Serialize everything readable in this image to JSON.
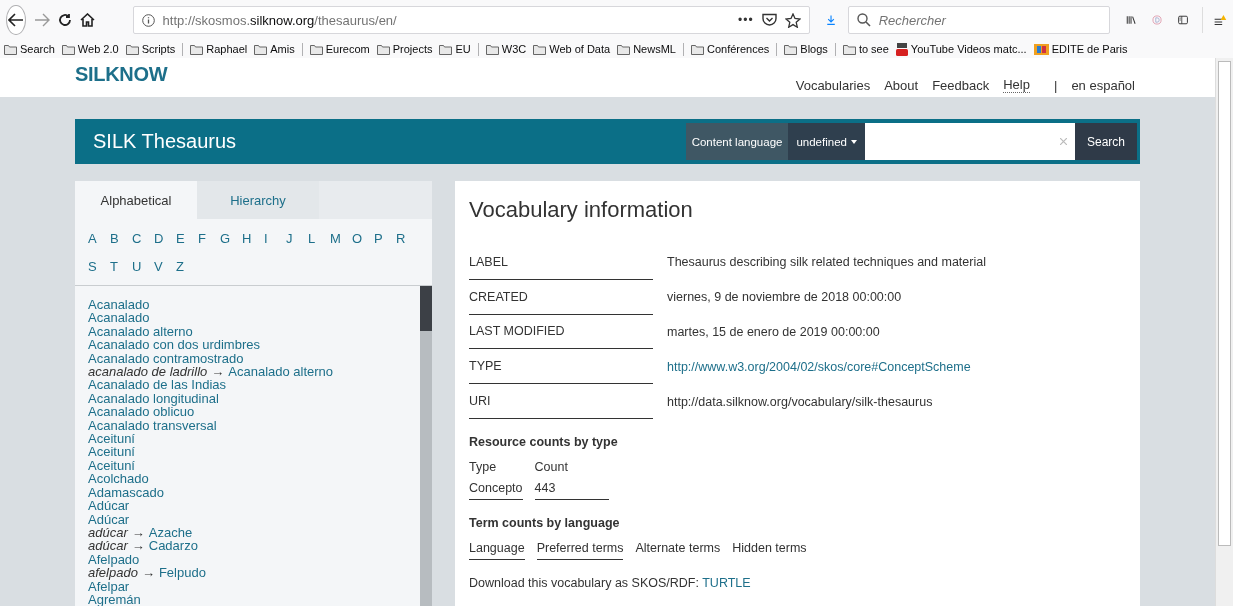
{
  "browser": {
    "url": {
      "prefix": "http://skosmos.",
      "host": "silknow.org",
      "path": "/thesaurus/en/"
    },
    "more": "•••",
    "search_placeholder": "Rechercher",
    "bookmarks": [
      {
        "kind": "folder",
        "label": "Search"
      },
      {
        "kind": "folder",
        "label": "Web 2.0"
      },
      {
        "kind": "folder",
        "label": "Scripts"
      },
      {
        "kind": "separator"
      },
      {
        "kind": "folder",
        "label": "Raphael"
      },
      {
        "kind": "folder",
        "label": "Amis"
      },
      {
        "kind": "separator"
      },
      {
        "kind": "folder",
        "label": "Eurecom"
      },
      {
        "kind": "folder",
        "label": "Projects"
      },
      {
        "kind": "folder",
        "label": "EU"
      },
      {
        "kind": "separator"
      },
      {
        "kind": "folder",
        "label": "W3C"
      },
      {
        "kind": "folder",
        "label": "Web of Data"
      },
      {
        "kind": "folder",
        "label": "NewsML"
      },
      {
        "kind": "separator"
      },
      {
        "kind": "folder",
        "label": "Conférences"
      },
      {
        "kind": "separator"
      },
      {
        "kind": "folder",
        "label": "Blogs"
      },
      {
        "kind": "separator"
      },
      {
        "kind": "folder",
        "label": "to see"
      },
      {
        "kind": "video",
        "label": "YouTube Videos matc..."
      },
      {
        "kind": "site",
        "label": "EDITE de Paris"
      }
    ]
  },
  "site": {
    "logo": "SILKNOW",
    "nav": [
      {
        "label": "Vocabularies",
        "kind": "link"
      },
      {
        "label": "About",
        "kind": "link"
      },
      {
        "label": "Feedback",
        "kind": "link"
      },
      {
        "label": "Help",
        "kind": "help"
      },
      {
        "label": "|",
        "kind": "divider"
      },
      {
        "label": "en español",
        "kind": "link"
      }
    ],
    "title": "SILK Thesaurus",
    "content_language_label": "Content language",
    "content_language_value": "undefined",
    "search_button": "Search"
  },
  "sidebar": {
    "tabs": [
      {
        "label": "Alphabetical",
        "selected": true
      },
      {
        "label": "Hierarchy",
        "selected": false
      }
    ],
    "letters": [
      "A",
      "B",
      "C",
      "D",
      "E",
      "F",
      "G",
      "H",
      "I",
      "J",
      "L",
      "M",
      "O",
      "P",
      "R",
      "S",
      "T",
      "U",
      "V",
      "Z"
    ],
    "terms": [
      {
        "kind": "term",
        "label": "Acanalado"
      },
      {
        "kind": "term",
        "label": "Acanalado"
      },
      {
        "kind": "term",
        "label": "Acanalado alterno"
      },
      {
        "kind": "term",
        "label": "Acanalado con dos urdimbres"
      },
      {
        "kind": "term",
        "label": "Acanalado contramostrado"
      },
      {
        "kind": "alt",
        "label": "acanalado de ladrillo",
        "arrow": "→",
        "target": "Acanalado alterno"
      },
      {
        "kind": "term",
        "label": "Acanalado de las Indias"
      },
      {
        "kind": "term",
        "label": "Acanalado longitudinal"
      },
      {
        "kind": "term",
        "label": "Acanalado oblicuo"
      },
      {
        "kind": "term",
        "label": "Acanalado transversal"
      },
      {
        "kind": "term",
        "label": "Aceituní"
      },
      {
        "kind": "term",
        "label": "Aceituní"
      },
      {
        "kind": "term",
        "label": "Aceituní"
      },
      {
        "kind": "term",
        "label": "Acolchado"
      },
      {
        "kind": "term",
        "label": "Adamascado"
      },
      {
        "kind": "term",
        "label": "Adúcar"
      },
      {
        "kind": "term",
        "label": "Adúcar"
      },
      {
        "kind": "alt",
        "label": "adúcar",
        "arrow": "→",
        "target": "Azache"
      },
      {
        "kind": "alt",
        "label": "adúcar",
        "arrow": "→",
        "target": "Cadarzo"
      },
      {
        "kind": "term",
        "label": "Afelpado"
      },
      {
        "kind": "alt",
        "label": "afelpado",
        "arrow": "→",
        "target": "Felpudo"
      },
      {
        "kind": "term",
        "label": "Afelpar"
      },
      {
        "kind": "term",
        "label": "Agremán"
      }
    ]
  },
  "info": {
    "title": "Vocabulary information",
    "rows": [
      {
        "label": "LABEL",
        "value": "Thesaurus describing silk related techniques and material",
        "kind": "text"
      },
      {
        "label": "CREATED",
        "value": "viernes, 9 de noviembre de 2018 00:00:00",
        "kind": "text"
      },
      {
        "label": "LAST MODIFIED",
        "value": "martes, 15 de enero de 2019 00:00:00",
        "kind": "text"
      },
      {
        "label": "TYPE",
        "value": "http://www.w3.org/2004/02/skos/core#ConceptScheme",
        "kind": "link"
      },
      {
        "label": "URI",
        "value": "http://data.silknow.org/vocabulary/silk-thesaurus",
        "kind": "text"
      }
    ],
    "resource_counts": {
      "title": "Resource counts by type",
      "columns": [
        "Type",
        "Count"
      ],
      "rows": [
        [
          "Concepto",
          "443"
        ]
      ]
    },
    "term_counts": {
      "title": "Term counts by language",
      "columns": [
        "Language",
        "Preferred terms",
        "Alternate terms",
        "Hidden terms"
      ]
    },
    "download": {
      "text": "Download this vocabulary as SKOS/RDF:",
      "link": "TURTLE"
    }
  }
}
